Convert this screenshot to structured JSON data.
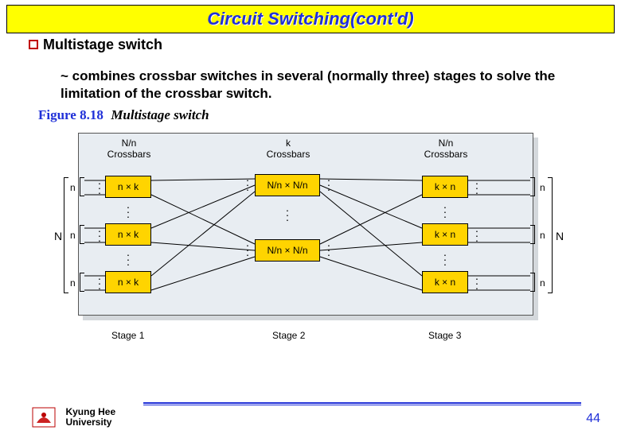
{
  "title": "Circuit Switching(cont'd)",
  "bullet": "Multistage switch",
  "description": "~ combines crossbar switches in several (normally three) stages to solve the limitation of the crossbar switch.",
  "figure": {
    "number": "Figure 8.18",
    "title": "Multistage switch"
  },
  "diagram": {
    "col_headers": {
      "stage1": {
        "top": "N/n",
        "bot": "Crossbars"
      },
      "stage2": {
        "top": "k",
        "bot": "Crossbars"
      },
      "stage3": {
        "top": "N/n",
        "bot": "Crossbars"
      }
    },
    "box_labels": {
      "stage1": "n × k",
      "stage2": "N/n × N/n",
      "stage3": "k × n"
    },
    "side_label": "n",
    "outer_label": "N",
    "stage_labels": {
      "s1": "Stage 1",
      "s2": "Stage 2",
      "s3": "Stage 3"
    }
  },
  "footer": {
    "university": "Kyung Hee\nUniversity",
    "page": "44"
  }
}
